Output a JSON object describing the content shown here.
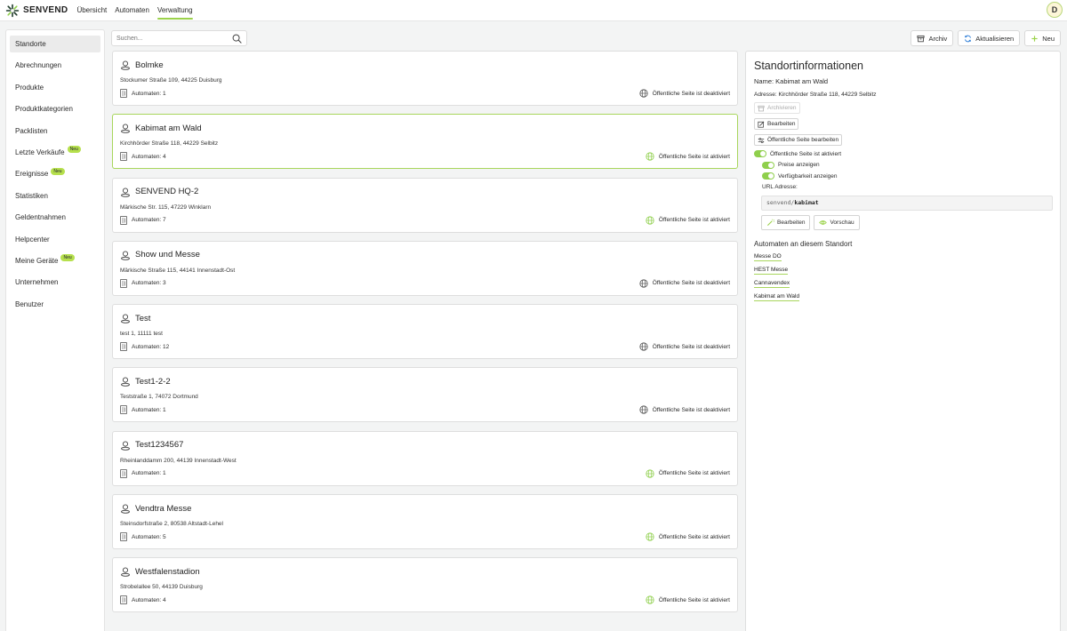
{
  "brand": {
    "name": "SENVEND",
    "accent": "#9bd24a"
  },
  "topnav": [
    {
      "label": "Übersicht",
      "active": false
    },
    {
      "label": "Automaten",
      "active": false
    },
    {
      "label": "Verwaltung",
      "active": true
    }
  ],
  "user": {
    "initial": "D"
  },
  "sidebar": {
    "items": [
      {
        "label": "Standorte",
        "active": true,
        "badge": ""
      },
      {
        "label": "Abrechnungen",
        "badge": ""
      },
      {
        "label": "Produkte",
        "badge": ""
      },
      {
        "label": "Produktkategorien",
        "badge": ""
      },
      {
        "label": "Packlisten",
        "badge": ""
      },
      {
        "label": "Letzte Verkäufe",
        "badge": "Neu"
      },
      {
        "label": "Ereignisse",
        "badge": "Neu"
      },
      {
        "label": "Statistiken",
        "badge": ""
      },
      {
        "label": "Geldentnahmen",
        "badge": ""
      },
      {
        "label": "Helpcenter",
        "badge": ""
      },
      {
        "label": "Meine Geräte",
        "badge": "Neu"
      },
      {
        "label": "Unternehmen",
        "badge": ""
      },
      {
        "label": "Benutzer",
        "badge": ""
      }
    ]
  },
  "search": {
    "placeholder": "Suchen...",
    "value": ""
  },
  "toolbar": {
    "archive_label": "Archiv",
    "refresh_label": "Aktualisieren",
    "new_label": "Neu"
  },
  "locations": [
    {
      "name": "Bolmke",
      "address": "Stockumer Straße 109, 44225 Duisburg",
      "count": "Automaten: 1",
      "status": "Öffentliche Seite ist deaktiviert",
      "public": false
    },
    {
      "name": "Kabimat am Wald",
      "address": "Kirchhörder Straße 118, 44229 Selbitz",
      "count": "Automaten: 4",
      "status": "Öffentliche Seite ist aktiviert",
      "public": true,
      "selected": true
    },
    {
      "name": "SENVEND HQ-2",
      "address": "Märkische Str. 115, 47229 Winklarn",
      "count": "Automaten: 7",
      "status": "Öffentliche Seite ist aktiviert",
      "public": true
    },
    {
      "name": "Show und Messe",
      "address": "Märkische Straße 115, 44141 Innenstadt-Ost",
      "count": "Automaten: 3",
      "status": "Öffentliche Seite ist deaktiviert",
      "public": false
    },
    {
      "name": "Test",
      "address": "test 1, 11111 test",
      "count": "Automaten: 12",
      "status": "Öffentliche Seite ist deaktiviert",
      "public": false
    },
    {
      "name": "Test1-2-2",
      "address": "Teststraße 1, 74072 Dortmund",
      "count": "Automaten: 1",
      "status": "Öffentliche Seite ist deaktiviert",
      "public": false
    },
    {
      "name": "Test1234567",
      "address": "Rheinlanddamm 200, 44139 Innenstadt-West",
      "count": "Automaten: 1",
      "status": "Öffentliche Seite ist aktiviert",
      "public": true
    },
    {
      "name": "Vendtra Messe",
      "address": "Steinsdorfstraße 2, 80538 Altstadt-Lehel",
      "count": "Automaten: 5",
      "status": "Öffentliche Seite ist aktiviert",
      "public": true
    },
    {
      "name": "Westfalenstadion",
      "address": "Strobelallee 50, 44139 Duisburg",
      "count": "Automaten: 4",
      "status": "Öffentliche Seite ist aktiviert",
      "public": true
    }
  ],
  "details": {
    "title": "Standortinformationen",
    "name": "Name: Kabimat am Wald",
    "address": "Adresse: Kirchhörder Straße 118, 44229 Selbitz",
    "archive_label": "Archivieren",
    "edit_label": "Bearbeiten",
    "public_edit_label": "Öffentliche Seite bearbeiten",
    "public_toggle_label": "Öffentliche Seite ist aktiviert",
    "prices_label": "Preise anzeigen",
    "availability_label": "Verfügbarkeit anzeigen",
    "url_label": "URL Adresse:",
    "url_prefix": "senvend/",
    "url_slug": "kabimat",
    "url_edit_label": "Bearbeiten",
    "preview_label": "Vorschau",
    "machines_title": "Automaten an diesem Standort",
    "machines": [
      "Messe DO",
      "HEST Messe",
      "Cannavendex",
      "Kabimat am Wald"
    ]
  }
}
